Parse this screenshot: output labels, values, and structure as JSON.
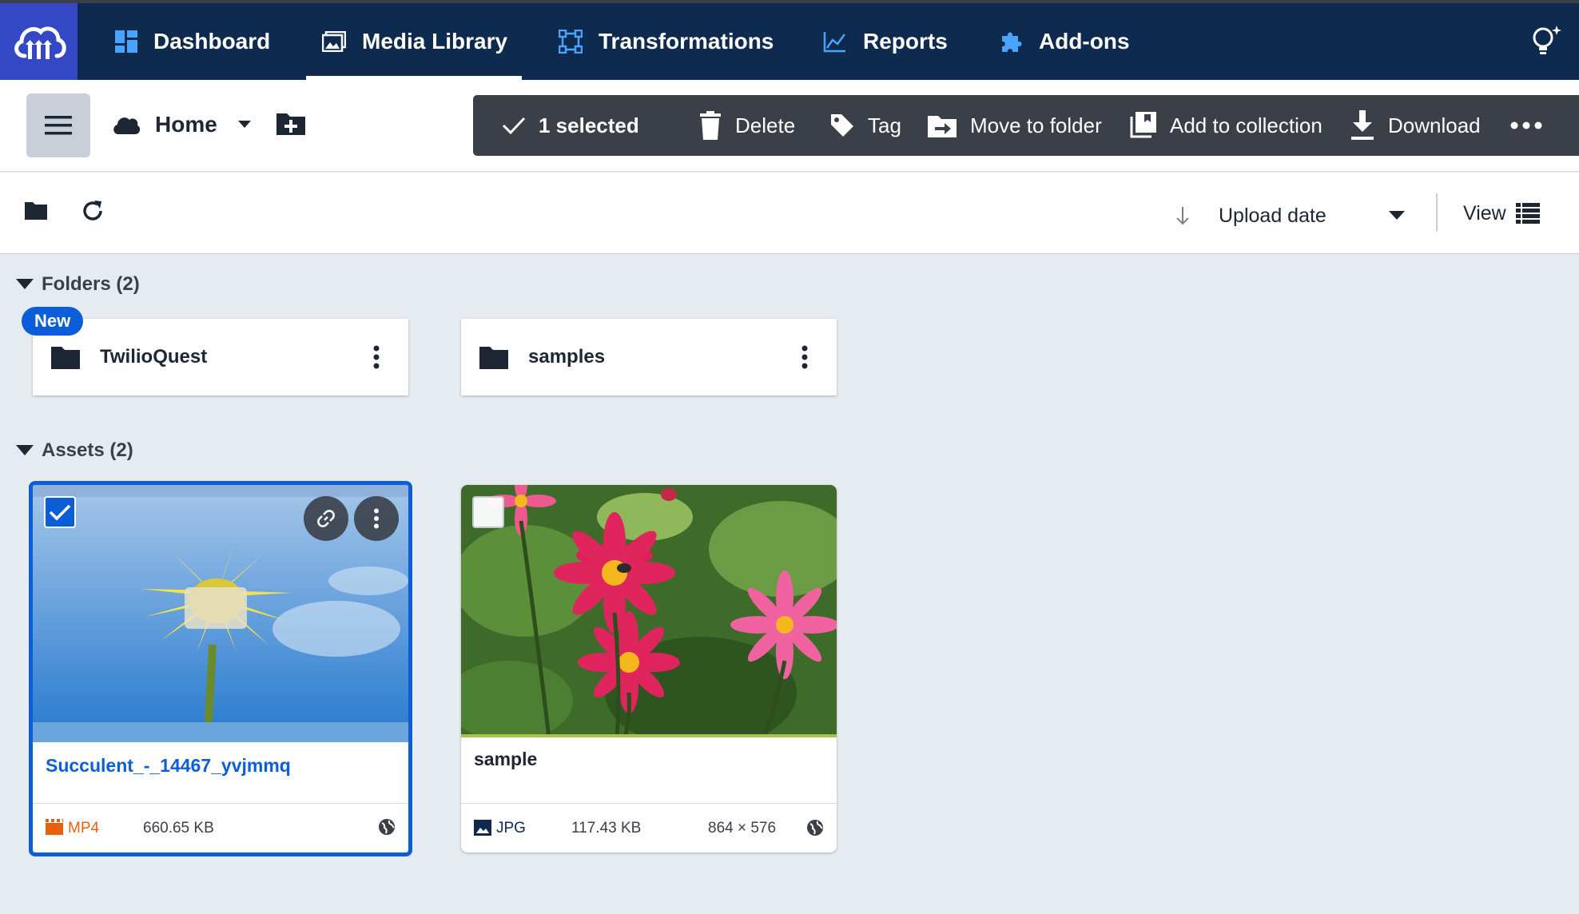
{
  "nav": {
    "items": [
      {
        "label": "Dashboard",
        "icon": "dashboard-icon"
      },
      {
        "label": "Media Library",
        "icon": "media-library-icon",
        "active": true
      },
      {
        "label": "Transformations",
        "icon": "transformations-icon"
      },
      {
        "label": "Reports",
        "icon": "reports-icon"
      },
      {
        "label": "Add-ons",
        "icon": "puzzle-icon"
      }
    ],
    "colors": {
      "background": "#0e2a4f",
      "logo_bg": "#3448c5"
    }
  },
  "toolbar": {
    "home_label": "Home",
    "selection": {
      "count_label": "1 selected",
      "actions": [
        "Delete",
        "Tag",
        "Move to folder",
        "Add to collection",
        "Download"
      ]
    }
  },
  "sort": {
    "label": "Upload date",
    "view_label": "View"
  },
  "folders": {
    "heading": "Folders (2)",
    "items": [
      {
        "name": "TwilioQuest",
        "badge": "New"
      },
      {
        "name": "samples"
      }
    ]
  },
  "assets": {
    "heading": "Assets (2)",
    "items": [
      {
        "name": "Succulent_-_14467_yvjmmq",
        "format": "MP4",
        "size": "660.65 KB",
        "dimensions": "",
        "selected": true
      },
      {
        "name": "sample",
        "format": "JPG",
        "size": "117.43 KB",
        "dimensions": "864 × 576",
        "selected": false
      }
    ]
  },
  "colors": {
    "accent": "#0b5ed7",
    "selection_bar": "#3a3f48",
    "mp4": "#e8600c",
    "jpg": "#0e2a4f"
  }
}
